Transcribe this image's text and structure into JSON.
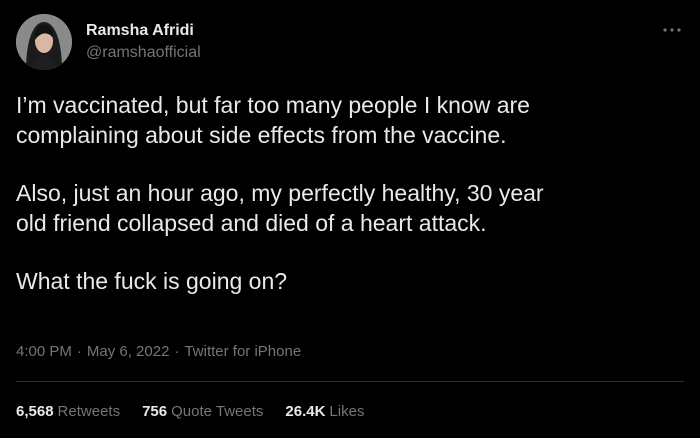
{
  "author": {
    "name": "Ramsha Afridi",
    "handle": "@ramshaofficial"
  },
  "tweet": {
    "paragraphs": [
      "I’m vaccinated, but far too many people I know are\ncomplaining about side effects from the vaccine.",
      "Also, just an hour ago, my perfectly healthy, 30 year\nold friend collapsed and died of a heart attack.",
      "What the fuck is going on?"
    ],
    "time": "4:00 PM",
    "date": "May 6, 2022",
    "source": "Twitter for iPhone",
    "separator": "·"
  },
  "stats": {
    "retweets_count": "6,568",
    "retweets_label": "Retweets",
    "quotes_count": "756",
    "quotes_label": "Quote Tweets",
    "likes_count": "26.4K",
    "likes_label": "Likes"
  },
  "icons": {
    "more": "more-horizontal-icon"
  },
  "colors": {
    "background": "#000000",
    "text_primary": "#e7e9ea",
    "text_secondary": "#71767b",
    "divider": "#2f3336"
  }
}
